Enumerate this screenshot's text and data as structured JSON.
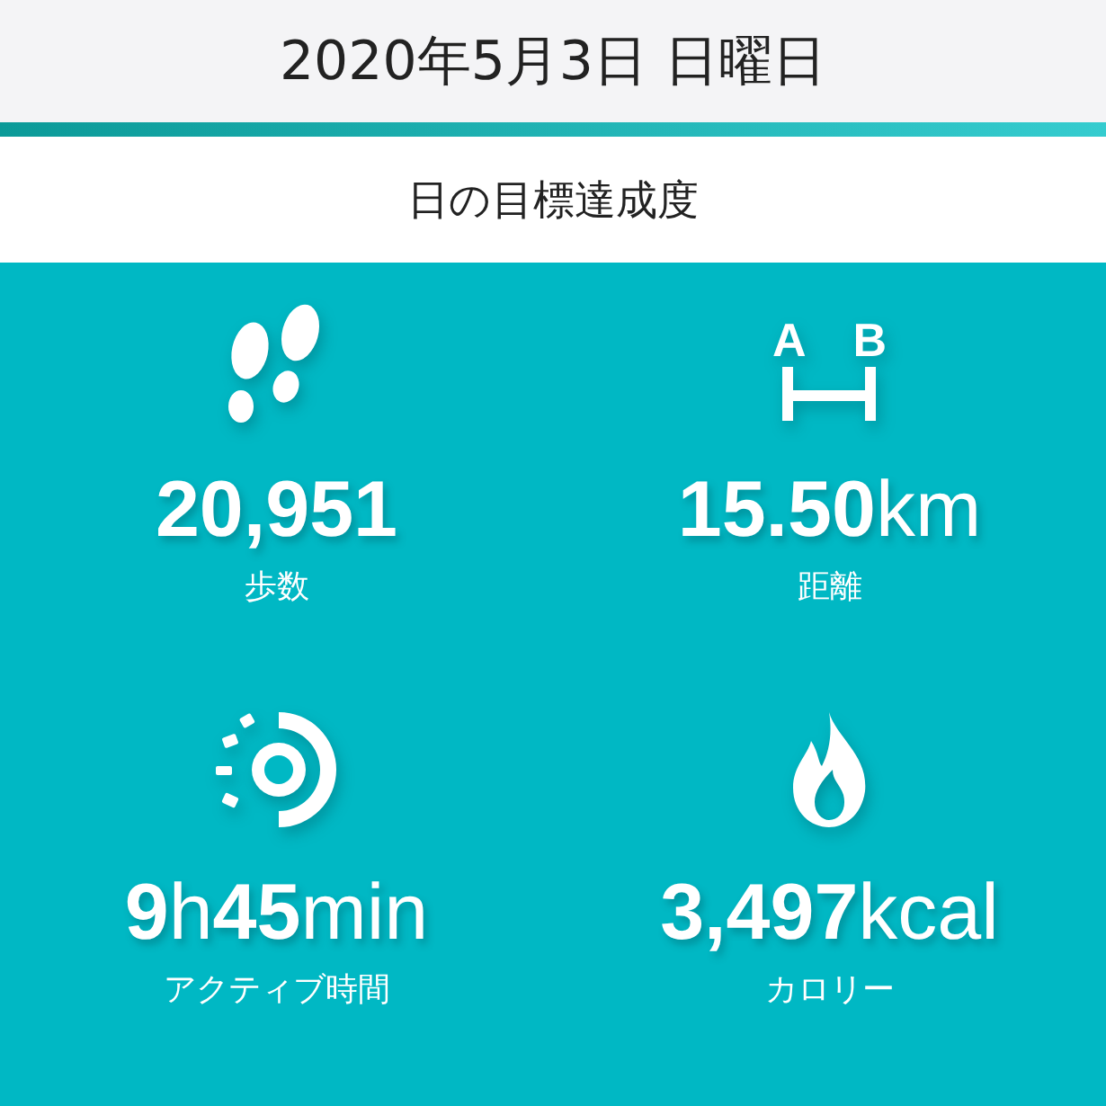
{
  "header": {
    "date": "2020年5月3日 日曜日"
  },
  "section": {
    "title": "日の目標達成度"
  },
  "distance_icon_letters": [
    "A",
    "B"
  ],
  "stats": [
    {
      "kind": "steps",
      "value": "20,951",
      "label": "歩数"
    },
    {
      "kind": "distance",
      "value": "**15.50**km",
      "label": "距離"
    },
    {
      "kind": "active",
      "value": "**9**h**45**min",
      "label": "アクティブ時間"
    },
    {
      "kind": "calories",
      "value": "**3,497**kcal",
      "label": "カロリー"
    }
  ]
}
